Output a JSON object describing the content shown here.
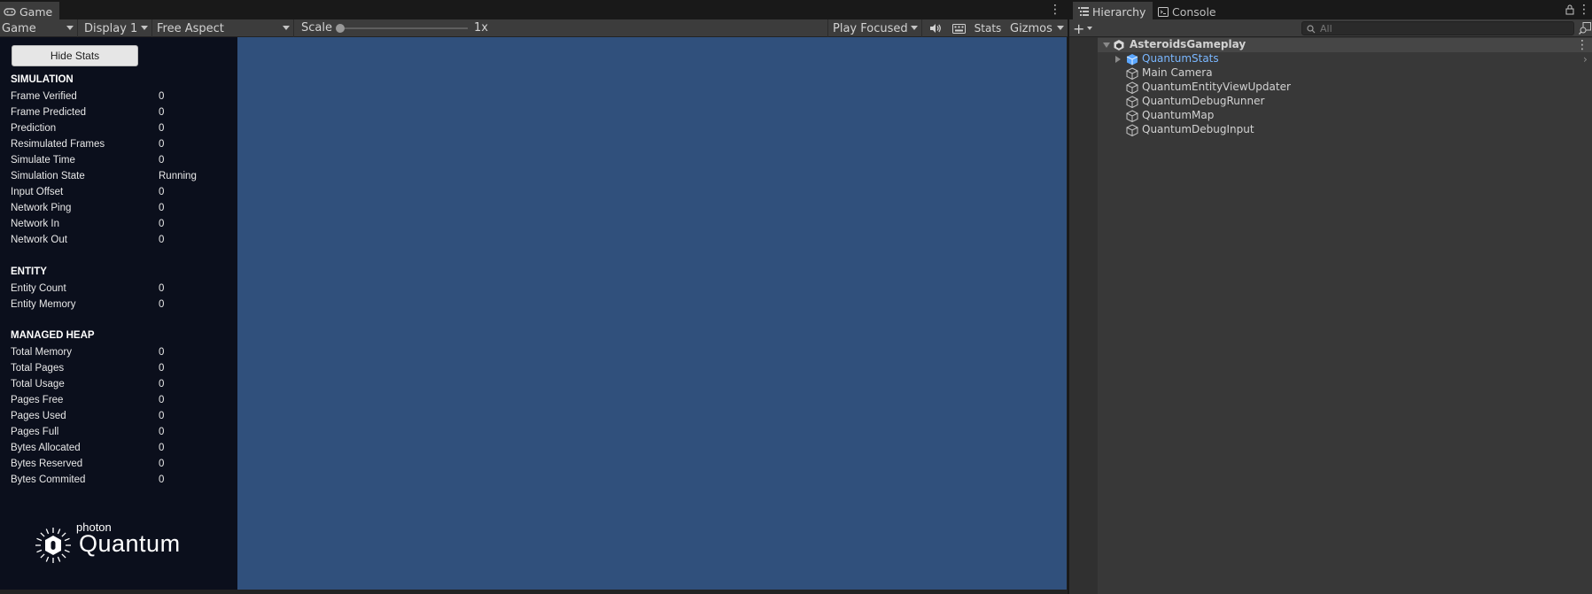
{
  "game_window": {
    "tab_label": "Game",
    "toolbar": {
      "view_mode": "Game",
      "display": "Display 1",
      "aspect": "Free Aspect",
      "scale_label": "Scale",
      "scale_value": "1x",
      "play_mode": "Play Focused",
      "stats_label": "Stats",
      "gizmos_label": "Gizmos"
    }
  },
  "stats_panel": {
    "hide_button": "Hide Stats",
    "sections": {
      "simulation": {
        "title": "SIMULATION",
        "rows": [
          {
            "label": "Frame Verified",
            "value": "0"
          },
          {
            "label": "Frame Predicted",
            "value": "0"
          },
          {
            "label": "Prediction",
            "value": "0"
          },
          {
            "label": "Resimulated Frames",
            "value": "0"
          },
          {
            "label": "Simulate Time",
            "value": "0"
          },
          {
            "label": "Simulation State",
            "value": "Running"
          },
          {
            "label": "Input Offset",
            "value": "0"
          },
          {
            "label": "Network Ping",
            "value": "0"
          },
          {
            "label": "Network In",
            "value": "0"
          },
          {
            "label": "Network Out",
            "value": "0"
          }
        ]
      },
      "entity": {
        "title": "ENTITY",
        "rows": [
          {
            "label": "Entity Count",
            "value": "0"
          },
          {
            "label": "Entity Memory",
            "value": "0"
          }
        ]
      },
      "managed_heap": {
        "title": "MANAGED HEAP",
        "rows": [
          {
            "label": "Total Memory",
            "value": "0"
          },
          {
            "label": "Total Pages",
            "value": "0"
          },
          {
            "label": "Total Usage",
            "value": "0"
          },
          {
            "label": "Pages Free",
            "value": "0"
          },
          {
            "label": "Pages Used",
            "value": "0"
          },
          {
            "label": "Pages Full",
            "value": "0"
          },
          {
            "label": "Bytes Allocated",
            "value": "0"
          },
          {
            "label": "Bytes Reserved",
            "value": "0"
          },
          {
            "label": "Bytes Commited",
            "value": "0"
          }
        ]
      }
    },
    "logo": {
      "small": "photon",
      "big": "Quantum"
    }
  },
  "hierarchy_window": {
    "tabs": [
      {
        "label": "Hierarchy",
        "icon": "list-icon"
      },
      {
        "label": "Console",
        "icon": "console-icon"
      }
    ],
    "search_placeholder": "All",
    "scene": {
      "name": "AsteroidsGameplay"
    },
    "objects": [
      {
        "name": "QuantumStats",
        "prefab": true
      },
      {
        "name": "Main Camera",
        "prefab": false
      },
      {
        "name": "QuantumEntityViewUpdater",
        "prefab": false
      },
      {
        "name": "QuantumDebugRunner",
        "prefab": false
      },
      {
        "name": "QuantumMap",
        "prefab": false
      },
      {
        "name": "QuantumDebugInput",
        "prefab": false
      }
    ]
  },
  "colors": {
    "viewport": "#30507c",
    "stats_bg": "#0b0f1c",
    "prefab_text": "#7ab7ff",
    "editor_bg": "#383838"
  }
}
